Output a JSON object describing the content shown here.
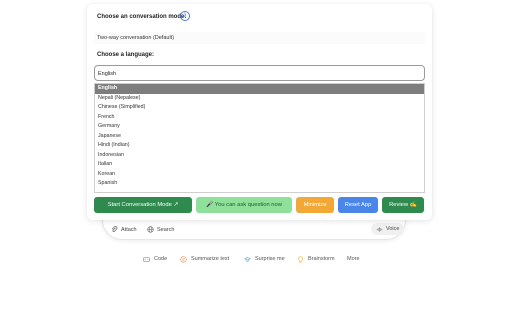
{
  "chatbar": {
    "attach_label": "Attach",
    "search_label": "Search",
    "voice_label": "Voice"
  },
  "panel": {
    "mode_label": "Choose an conversation mode:",
    "mode_value": "Two-way conversation (Default)",
    "language_label": "Choose a language:",
    "language_value": "English",
    "language_options": [
      "English",
      "Nepali (Nepalese)",
      "Chinese (Simplified)",
      "French",
      "Germany",
      "Japanese",
      "Hindi (Indian)",
      "Indonesian",
      "Italian",
      "Korean",
      "Spanish"
    ],
    "buttons": {
      "start": "Start Conversation Mode ↗",
      "ask": "🎤 You can ask question now",
      "minimize": "Minimize",
      "reset": "Reset App",
      "review": "Review ✍"
    }
  },
  "chips": {
    "code": "Code",
    "summarize": "Summarize text",
    "surprise": "Surprise me",
    "brainstorm": "Brainstorm",
    "more": "More"
  },
  "colors": {
    "primary_green": "#2f8a4e",
    "light_green": "#8ee09a",
    "orange": "#f2a836",
    "blue": "#4a86e8",
    "selected_option": "#7d7d7d"
  }
}
